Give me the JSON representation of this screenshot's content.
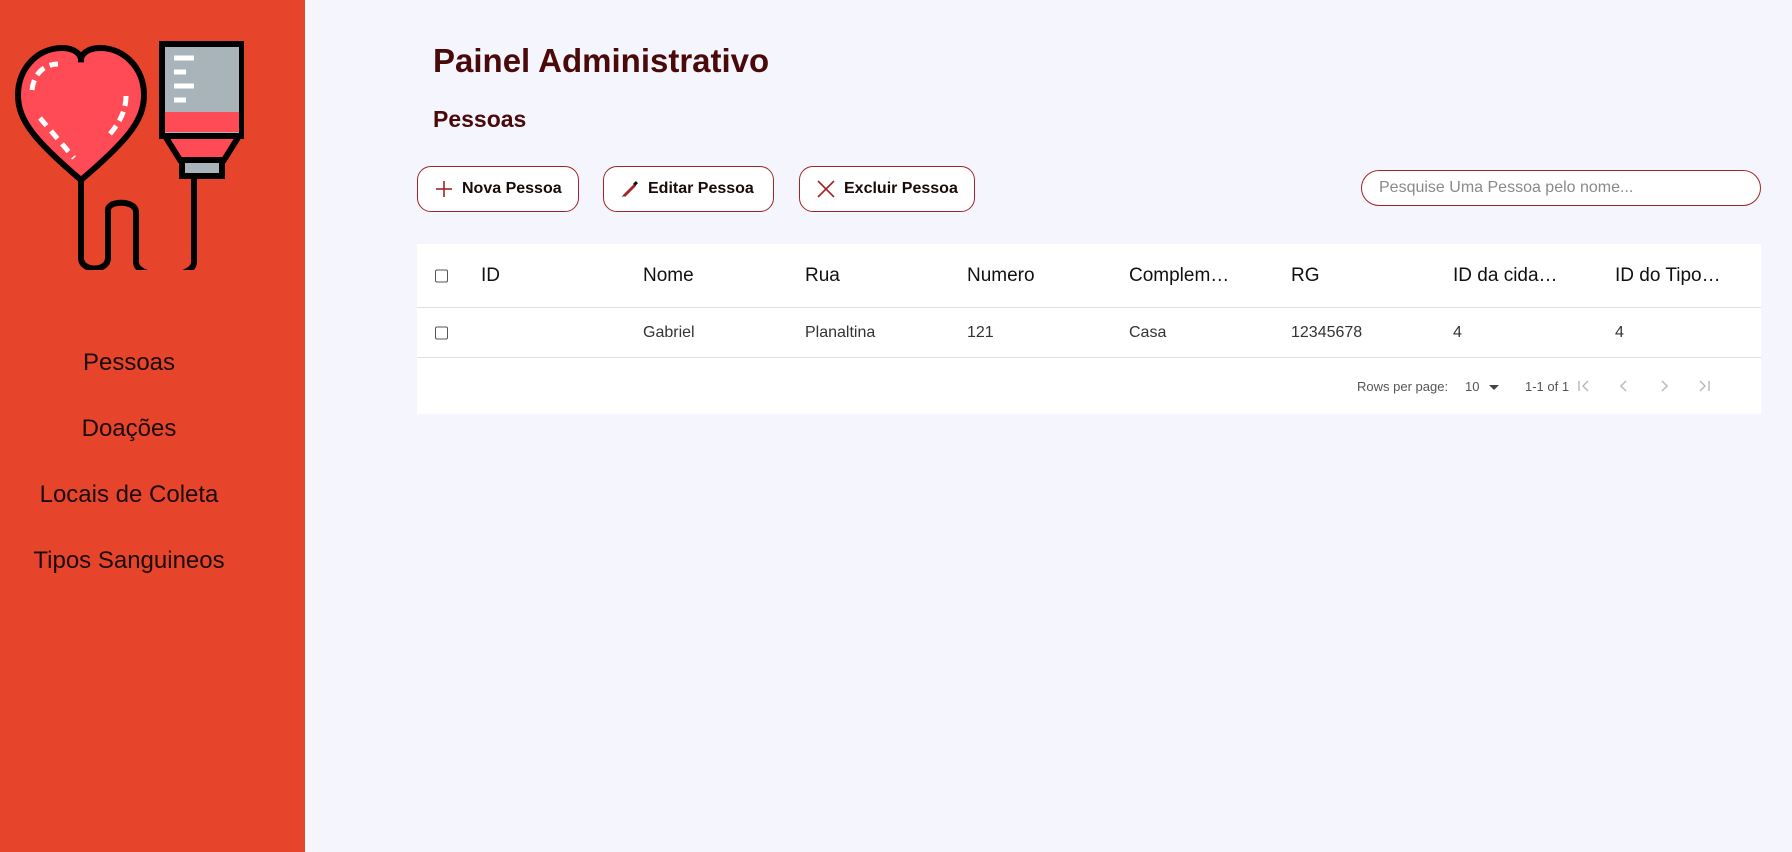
{
  "nav": {
    "items": [
      {
        "label": "Pessoas"
      },
      {
        "label": "Doações"
      },
      {
        "label": "Locais de Coleta"
      },
      {
        "label": "Tipos Sanguineos"
      }
    ]
  },
  "header": {
    "title": "Painel Administrativo",
    "section": "Pessoas"
  },
  "toolbar": {
    "new_label": "Nova Pessoa",
    "edit_label": "Editar Pessoa",
    "delete_label": "Excluir Pessoa"
  },
  "search": {
    "placeholder": "Pesquise Uma Pessoa pelo nome...",
    "value": ""
  },
  "table": {
    "columns": [
      "ID",
      "Nome",
      "Rua",
      "Numero",
      "Complem…",
      "RG",
      "ID da cida…",
      "ID do Tipo…"
    ],
    "rows": [
      [
        "",
        "Gabriel",
        "Planaltina",
        "121",
        "Casa",
        "12345678",
        "4",
        "4"
      ]
    ]
  },
  "pagination": {
    "rows_per_page_label": "Rows per page:",
    "rows_per_page": "10",
    "range": "1-1 of 1"
  },
  "colors": {
    "sidebar": "#e6452b",
    "accent": "#a32424",
    "title": "#4a0a0a",
    "background": "#f5f5fd"
  }
}
